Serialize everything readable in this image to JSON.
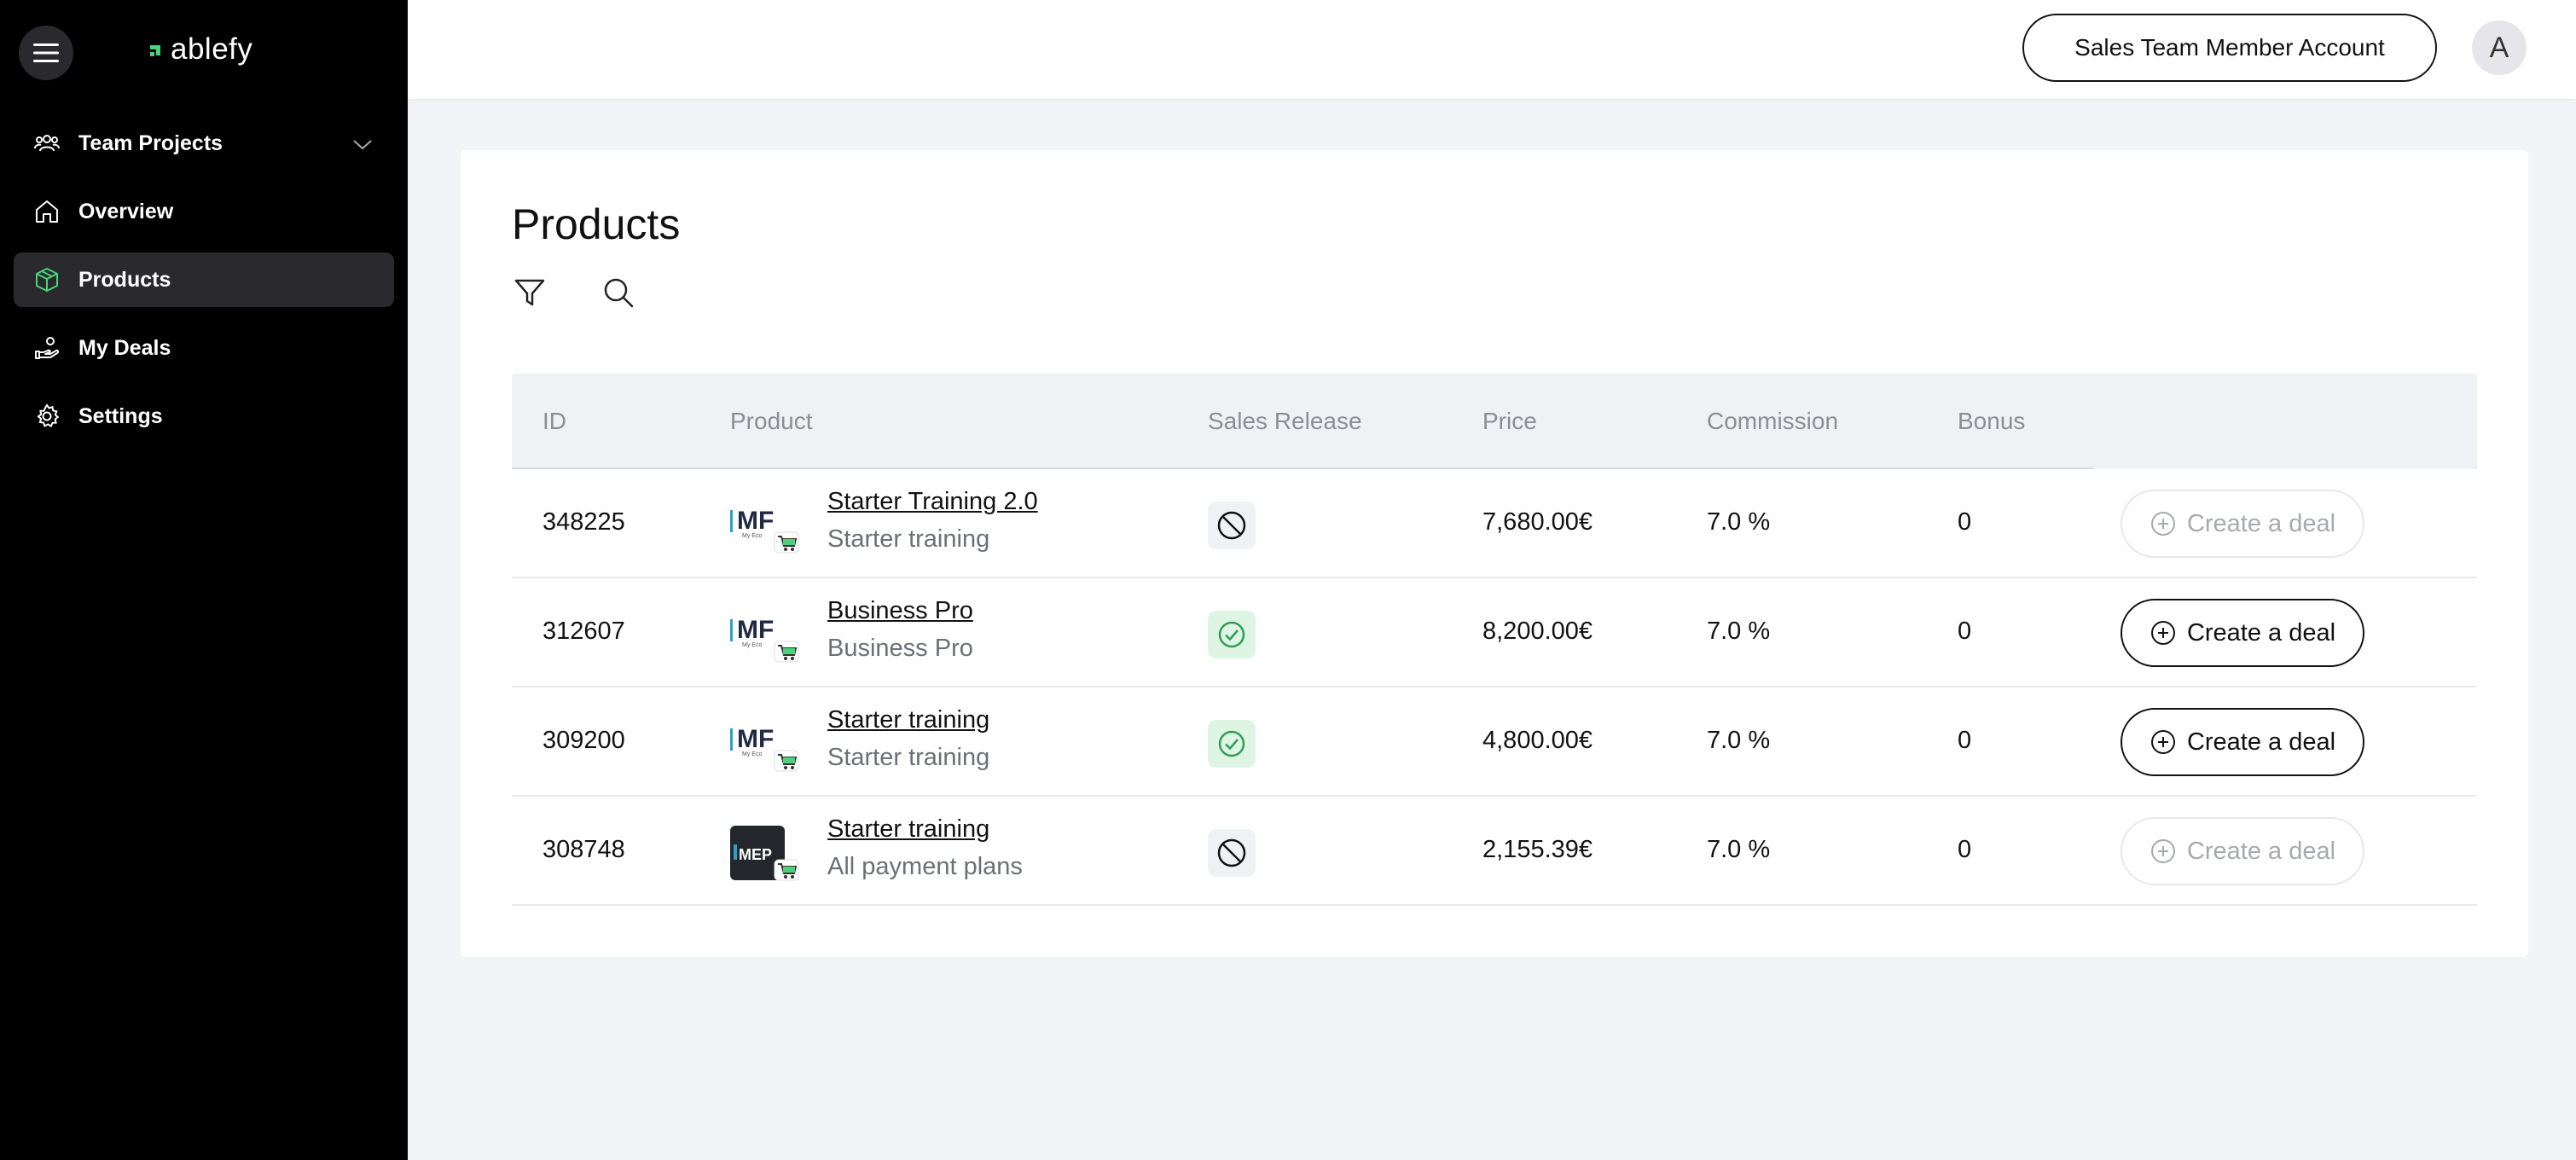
{
  "sidebar": {
    "logo_text": "ablefy",
    "brand_color": "#4bd27a",
    "items": [
      {
        "label": "Team Projects",
        "icon": "team-icon",
        "active": false,
        "expandable": true
      },
      {
        "label": "Overview",
        "icon": "home-icon",
        "active": false
      },
      {
        "label": "Products",
        "icon": "box-icon",
        "active": true
      },
      {
        "label": "My Deals",
        "icon": "hand-coins-icon",
        "active": false
      },
      {
        "label": "Settings",
        "icon": "gear-icon",
        "active": false
      }
    ]
  },
  "topbar": {
    "account_label": "Sales Team Member Account",
    "avatar_initial": "A"
  },
  "main": {
    "title": "Products",
    "tools": [
      "filter-icon",
      "search-icon"
    ]
  },
  "table": {
    "headers": {
      "id": "ID",
      "product": "Product",
      "release": "Sales Release",
      "price": "Price",
      "commission": "Commission",
      "bonus": "Bonus"
    },
    "rows": [
      {
        "id": "348225",
        "name": "Starter Training 2.0",
        "subtitle": "Starter training",
        "release": "blocked",
        "price": "7,680.00€",
        "commission": "7.0 %",
        "bonus": "0",
        "deal_label": "Create a deal",
        "deal_enabled": false
      },
      {
        "id": "312607",
        "name": "Business Pro",
        "subtitle": "Business Pro",
        "release": "released",
        "price": "8,200.00€",
        "commission": "7.0 %",
        "bonus": "0",
        "deal_label": "Create a deal",
        "deal_enabled": true
      },
      {
        "id": "309200",
        "name": "Starter training",
        "subtitle": "Starter training",
        "release": "released",
        "price": "4,800.00€",
        "commission": "7.0 %",
        "bonus": "0",
        "deal_label": "Create a deal",
        "deal_enabled": true
      },
      {
        "id": "308748",
        "name": "Starter training",
        "subtitle": "All payment plans",
        "release": "blocked",
        "price": "2,155.39€",
        "commission": "7.0 %",
        "bonus": "0",
        "deal_label": "Create a deal",
        "deal_enabled": false
      }
    ]
  },
  "colors": {
    "release_ok": "#2e9e55",
    "release_ok_bg": "#dff5e4"
  }
}
